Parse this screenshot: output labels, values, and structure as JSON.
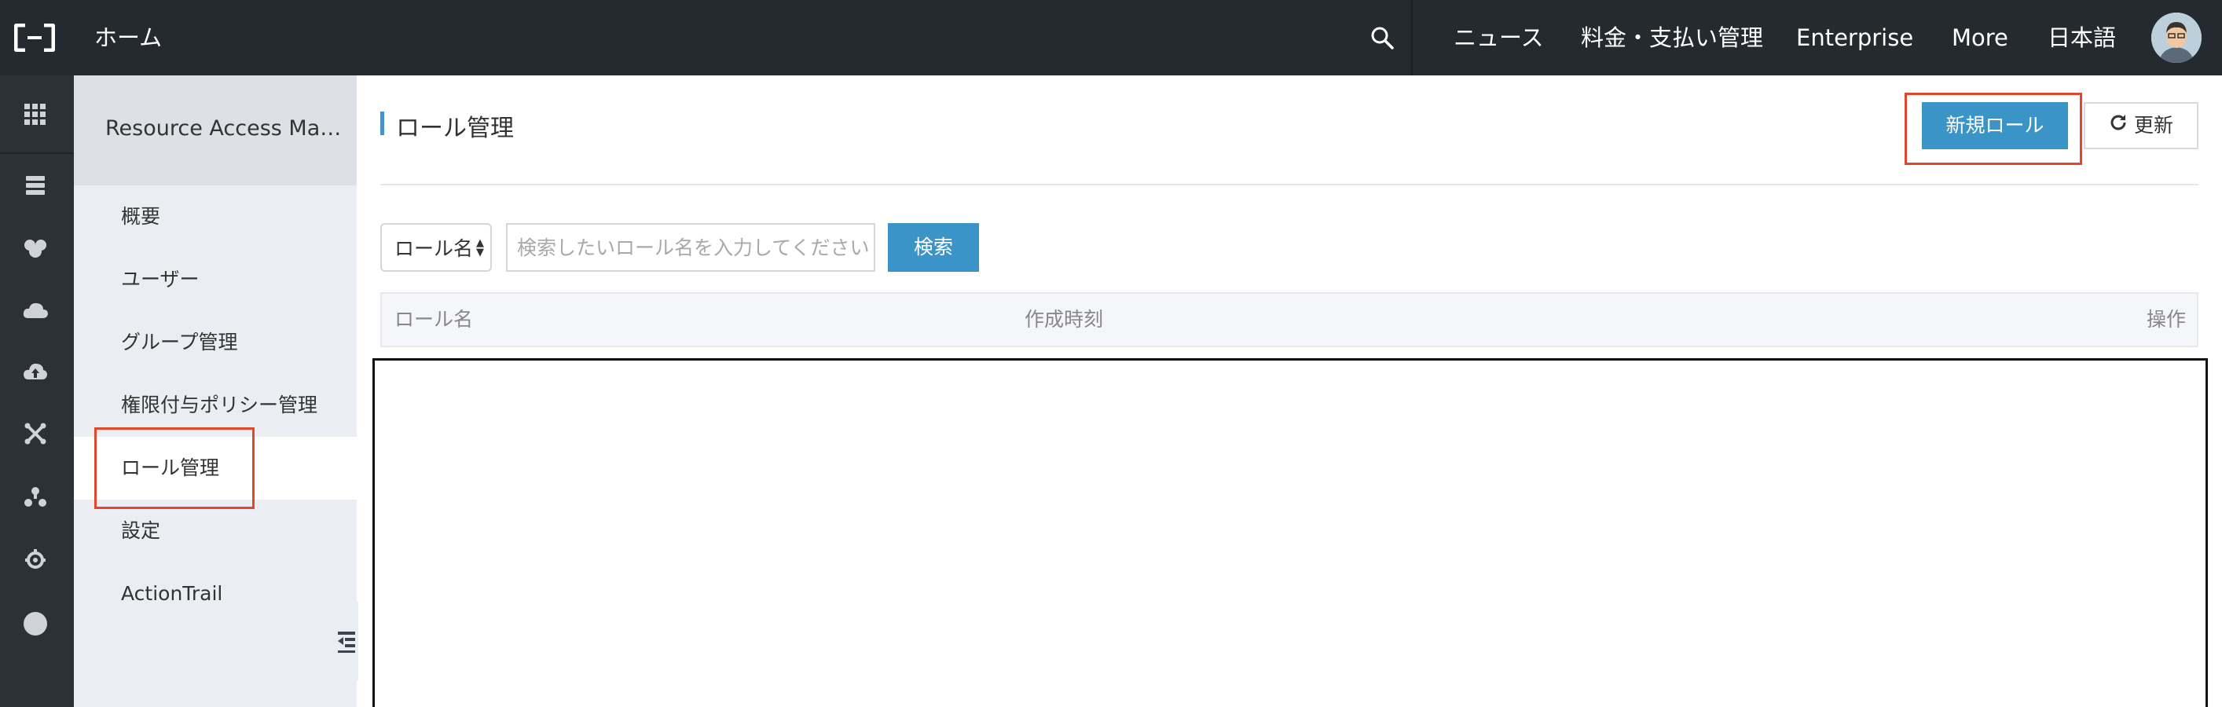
{
  "topbar": {
    "home_label": "ホーム",
    "links": {
      "news": "ニュース",
      "billing": "料金・支払い管理",
      "enterprise": "Enterprise",
      "more": "More",
      "language": "日本語"
    },
    "icons": {
      "logo": "aliyun-logo-icon",
      "search": "search-icon",
      "avatar": "user-avatar"
    }
  },
  "rail": {
    "icons": [
      "grid-icon",
      "server-icon",
      "database-icon",
      "cloud-icon",
      "cloud-upload-icon",
      "network-icon",
      "nodes-icon",
      "settings-icon",
      "dot-icon"
    ]
  },
  "subnav": {
    "title": "Resource Access Man…",
    "items": [
      {
        "label": "概要"
      },
      {
        "label": "ユーザー"
      },
      {
        "label": "グループ管理"
      },
      {
        "label": "権限付与ポリシー管理"
      },
      {
        "label": "ロール管理"
      },
      {
        "label": "設定"
      },
      {
        "label": "ActionTrail"
      }
    ],
    "active_item": "ロール管理"
  },
  "main": {
    "page_title": "ロール管理",
    "new_role_button": "新規ロール",
    "refresh_button": "更新",
    "filter": {
      "select_value": "ロール名",
      "search_placeholder": "検索したいロール名を入力してください",
      "search_button": "検索"
    },
    "table": {
      "columns": [
        "ロール名",
        "作成時刻",
        "操作"
      ]
    }
  },
  "colors": {
    "topbar_bg": "#252a30",
    "rail_bg": "#2b3137",
    "subnav_bg": "#eaedf1",
    "primary": "#3b94c8",
    "highlight": "#e1472c"
  }
}
